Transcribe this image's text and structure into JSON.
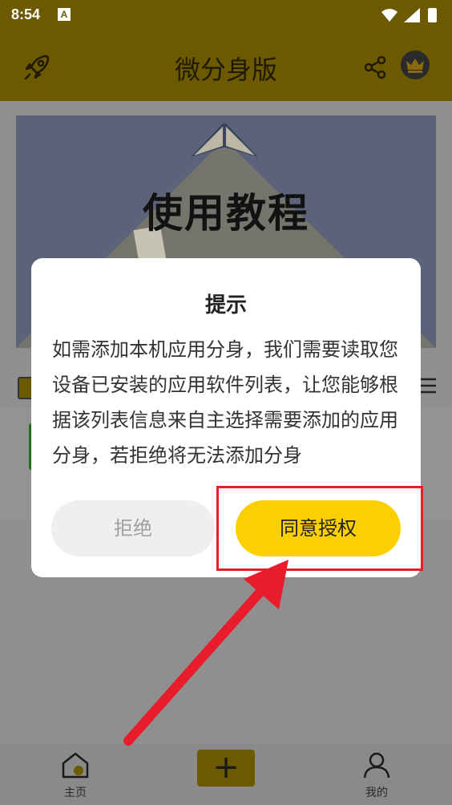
{
  "status_bar": {
    "time": "8:54",
    "notification_badge": "A"
  },
  "app_bar": {
    "title": "微分身版"
  },
  "banner": {
    "text": "使用教程"
  },
  "dialog": {
    "title": "提示",
    "message": "如需添加本机应用分身，我们需要读取您设备已安装的应用软件列表，让您能够根据该列表信息来自主选择需要添加的应用分身，若拒绝将无法添加分身",
    "refuse_label": "拒绝",
    "agree_label": "同意授权"
  },
  "bottom_nav": {
    "home_label": "主页",
    "add_label": "+",
    "mine_label": "我的"
  },
  "colors": {
    "appbar": "#6d5a00",
    "dialog_accent": "#fcd000",
    "annotation_red": "#e81c2a"
  }
}
